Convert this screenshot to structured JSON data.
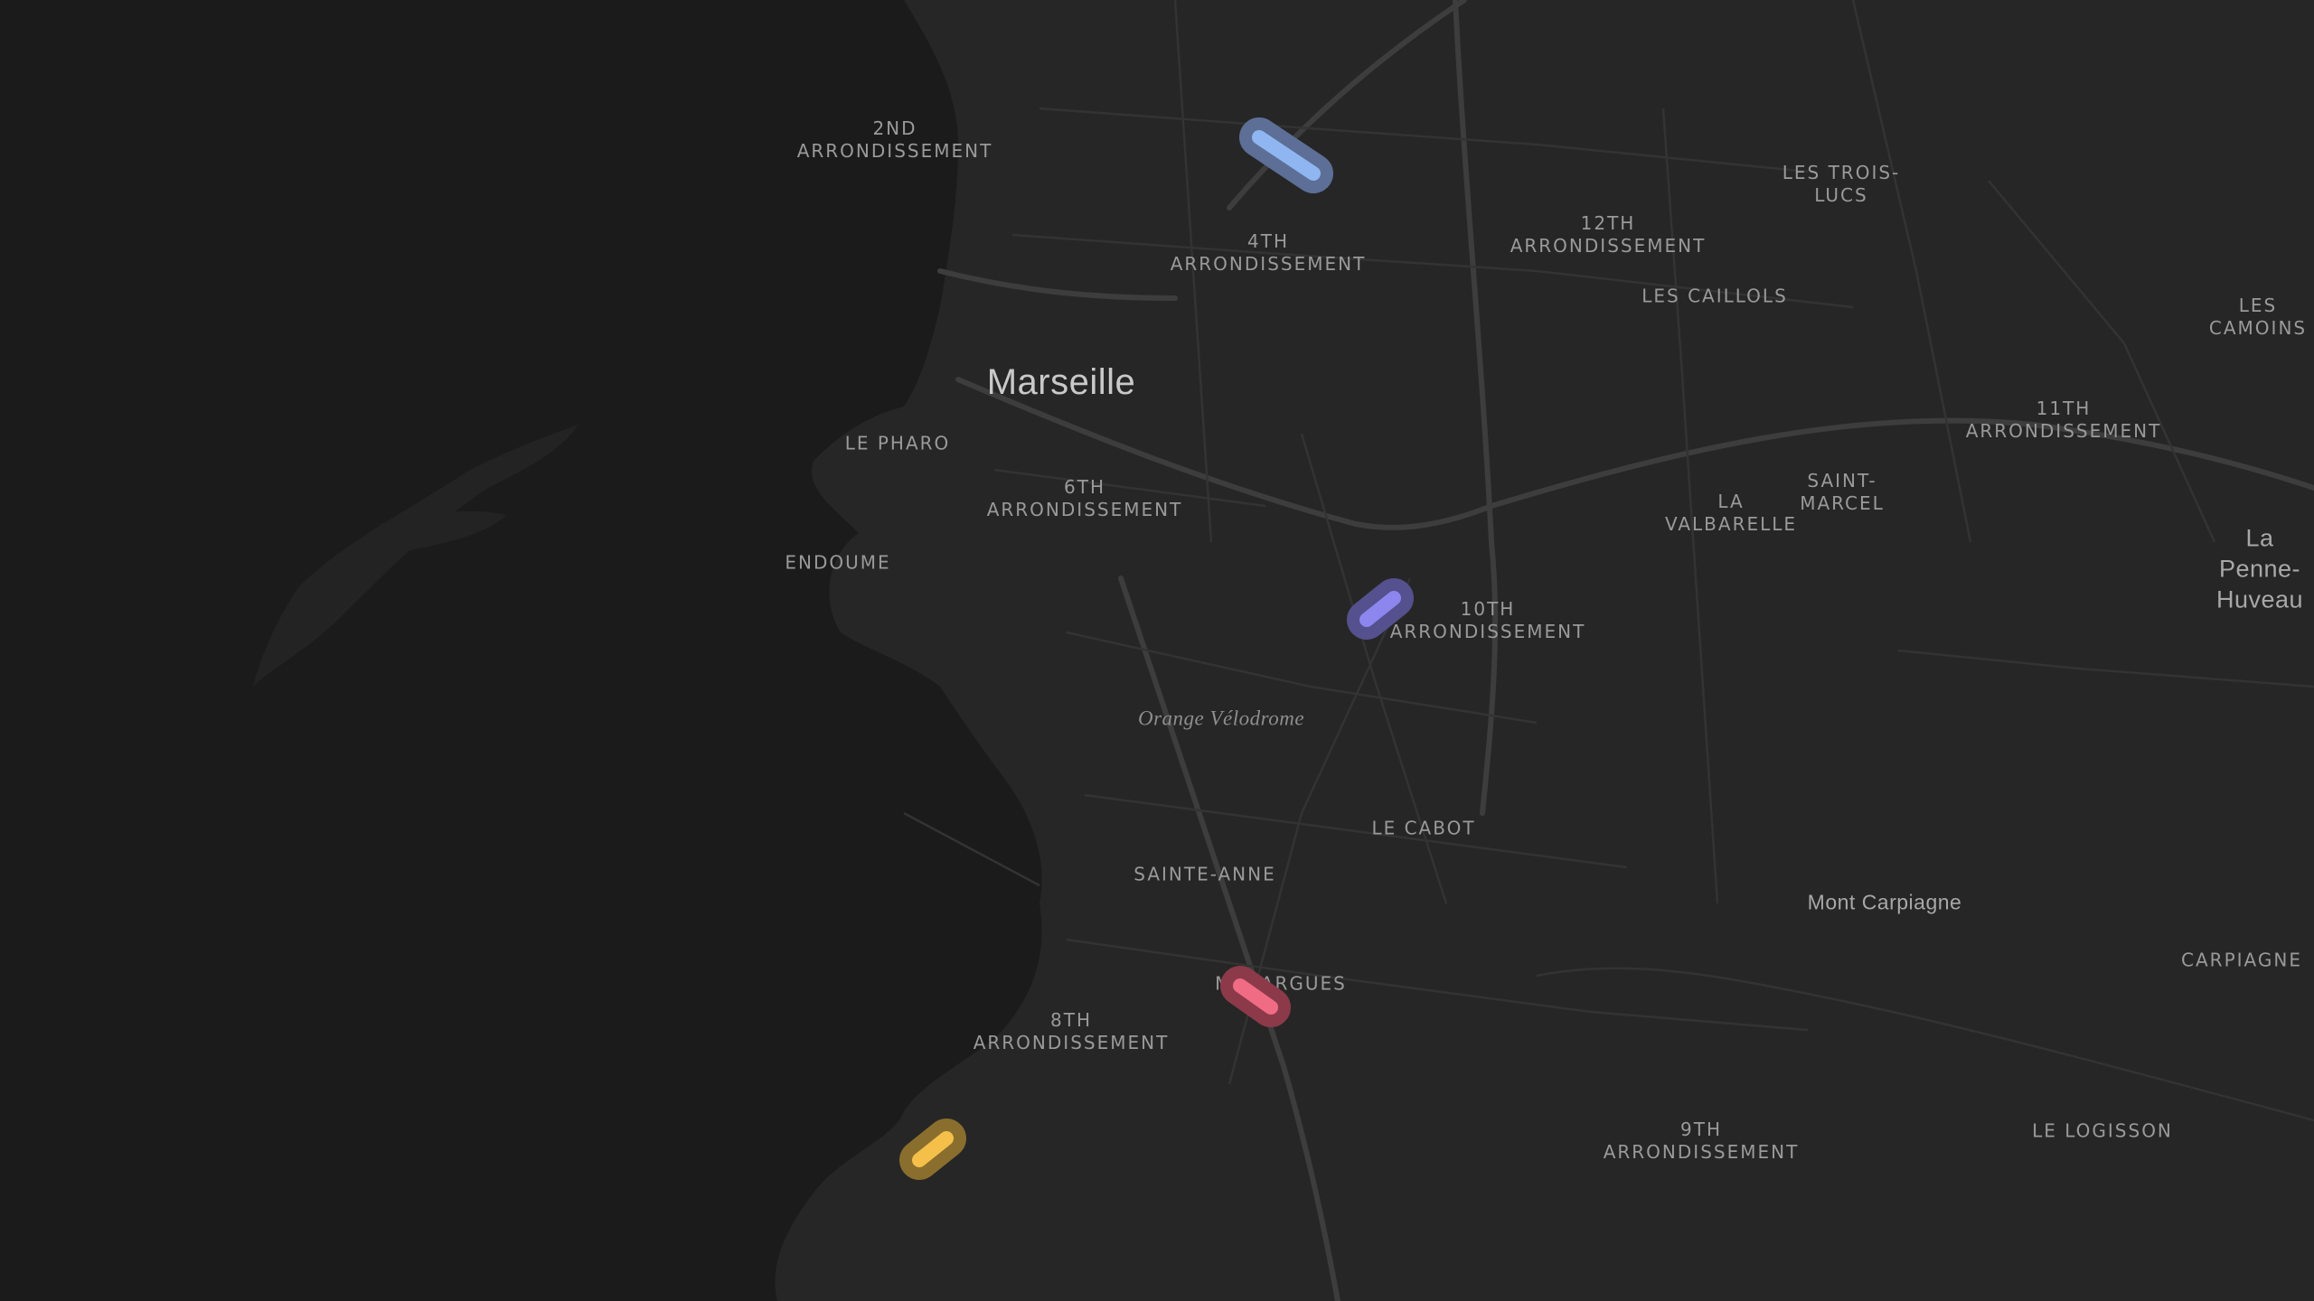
{
  "map": {
    "colors": {
      "sea": "#1b1b1b",
      "land": "#262626",
      "road": "#363636",
      "major_road": "#3d3d3d"
    },
    "city_label": "Marseille",
    "district_labels": [
      "2ND\nARRONDISSEMENT",
      "4TH\nARRONDISSEMENT",
      "12TH\nARRONDISSEMENT",
      "6TH\nARRONDISSEMENT",
      "10TH\nARRONDISSEMENT",
      "8TH\nARRONDISSEMENT",
      "9TH\nARRONDISSEMENT",
      "11TH\nARRONDISSEMENT"
    ],
    "neighborhood_labels": [
      "LES TROIS-\nLUCS",
      "LES CAILLOLS",
      "LES CAMOINS",
      "LE PHARO",
      "LA\nVALBARELLE",
      "SAINT-\nMARCEL",
      "ENDOUME",
      "LE CABOT",
      "SAINTE-ANNE",
      "MAZARGUES",
      "CARPIAGNE",
      "LE LOGISSON"
    ],
    "town_labels": [
      "La Penne-\nHuveau"
    ],
    "poi_labels": [
      "Orange Vélodrome"
    ],
    "peak_labels": [
      "Mont Carpiagne"
    ],
    "markers": [
      {
        "name": "blue",
        "color": "#8fb6f0",
        "halo": "#5d6f96"
      },
      {
        "name": "violet",
        "color": "#8c86ee",
        "halo": "#55508e"
      },
      {
        "name": "red",
        "color": "#f06c84",
        "halo": "#8c3a4a"
      },
      {
        "name": "gold",
        "color": "#f4c04a",
        "halo": "#8a6e2e"
      }
    ]
  }
}
